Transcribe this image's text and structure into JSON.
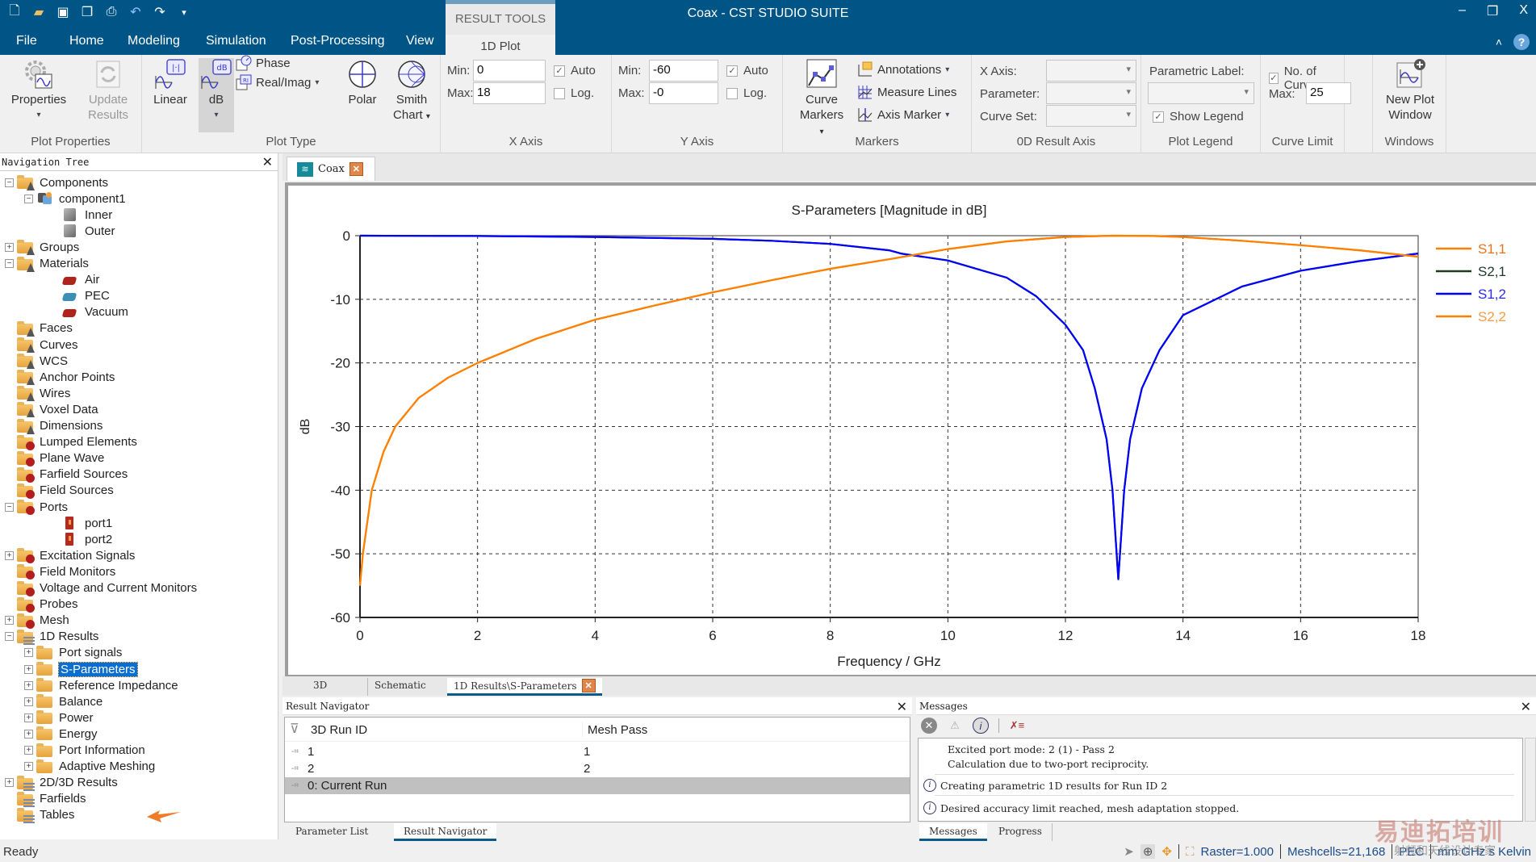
{
  "titlebar": {
    "title": "Coax - CST STUDIO SUITE",
    "qat_icons": [
      "new-icon",
      "open-icon",
      "save-icon",
      "copy-icon",
      "print-icon",
      "undo-icon",
      "redo-icon",
      "customize-icon"
    ],
    "window_controls": [
      "minimize",
      "restore",
      "close"
    ]
  },
  "tabs": {
    "items": [
      "File",
      "Home",
      "Modeling",
      "Simulation",
      "Post-Processing",
      "View"
    ],
    "context_header": "RESULT TOOLS",
    "context_tab": "1D Plot",
    "help": "?"
  },
  "ribbon": {
    "plot_properties": {
      "label": "Plot Properties",
      "properties": "Properties",
      "update_results_line1": "Update",
      "update_results_line2": "Results"
    },
    "plot_type": {
      "label": "Plot Type",
      "linear": "Linear",
      "db": "dB",
      "phase": "Phase",
      "real_imag": "Real/Imag",
      "polar": "Polar",
      "smith_line1": "Smith",
      "smith_line2": "Chart"
    },
    "x_axis": {
      "label": "X Axis",
      "min_label": "Min:",
      "min_value": "0",
      "max_label": "Max:",
      "max_value": "18",
      "auto_label": "Auto",
      "auto_checked": true,
      "log_label": "Log.",
      "log_checked": false
    },
    "y_axis": {
      "label": "Y Axis",
      "min_label": "Min:",
      "min_value": "-60",
      "max_label": "Max:",
      "max_value": "-0",
      "auto_label": "Auto",
      "auto_checked": true,
      "log_label": "Log.",
      "log_checked": false
    },
    "markers": {
      "label": "Markers",
      "curve_markers_line1": "Curve",
      "curve_markers_line2": "Markers",
      "annotations": "Annotations",
      "measure_lines": "Measure Lines",
      "axis_marker": "Axis Marker"
    },
    "result_axis_0d": {
      "label": "0D Result Axis",
      "x_axis_label": "X Axis:",
      "parameter_label": "Parameter:",
      "curve_set_label": "Curve Set:",
      "x_axis_value": "",
      "parameter_value": "",
      "curve_set_value": ""
    },
    "plot_legend": {
      "label": "Plot Legend",
      "parametric_label": "Parametric Label:",
      "parametric_value": "",
      "show_legend": "Show Legend",
      "show_legend_checked": true
    },
    "curve_limit": {
      "label": "Curve Limit",
      "no_of_curves": "No. of Curves",
      "no_of_curves_checked": true,
      "max_label": "Max:",
      "max_value": "25"
    },
    "windows": {
      "label": "Windows",
      "new_plot_line1": "New Plot",
      "new_plot_line2": "Window"
    }
  },
  "nav": {
    "title": "Navigation Tree",
    "items": [
      {
        "label": "Components",
        "level": 0,
        "toggle": "-",
        "icon": "folder-geometry"
      },
      {
        "label": "component1",
        "level": 1,
        "toggle": "-",
        "icon": "component"
      },
      {
        "label": "Inner",
        "level": 2,
        "toggle": "",
        "icon": "solid"
      },
      {
        "label": "Outer",
        "level": 2,
        "toggle": "",
        "icon": "solid"
      },
      {
        "label": "Groups",
        "level": 0,
        "toggle": "+",
        "icon": "folder-geometry"
      },
      {
        "label": "Materials",
        "level": 0,
        "toggle": "-",
        "icon": "folder-geometry"
      },
      {
        "label": "Air",
        "level": 2,
        "toggle": "",
        "icon": "material-red"
      },
      {
        "label": "PEC",
        "level": 2,
        "toggle": "",
        "icon": "material-blue"
      },
      {
        "label": "Vacuum",
        "level": 2,
        "toggle": "",
        "icon": "material-red"
      },
      {
        "label": "Faces",
        "level": 0,
        "toggle": "",
        "icon": "folder-geometry"
      },
      {
        "label": "Curves",
        "level": 0,
        "toggle": "",
        "icon": "folder-geometry"
      },
      {
        "label": "WCS",
        "level": 0,
        "toggle": "",
        "icon": "folder-geometry"
      },
      {
        "label": "Anchor Points",
        "level": 0,
        "toggle": "",
        "icon": "folder-geometry"
      },
      {
        "label": "Wires",
        "level": 0,
        "toggle": "",
        "icon": "folder-geometry"
      },
      {
        "label": "Voxel Data",
        "level": 0,
        "toggle": "",
        "icon": "folder-geometry"
      },
      {
        "label": "Dimensions",
        "level": 0,
        "toggle": "",
        "icon": "folder-geometry"
      },
      {
        "label": "Lumped Elements",
        "level": 0,
        "toggle": "",
        "icon": "folder-simulation"
      },
      {
        "label": "Plane Wave",
        "level": 0,
        "toggle": "",
        "icon": "folder-simulation"
      },
      {
        "label": "Farfield Sources",
        "level": 0,
        "toggle": "",
        "icon": "folder-simulation"
      },
      {
        "label": "Field Sources",
        "level": 0,
        "toggle": "",
        "icon": "folder-simulation"
      },
      {
        "label": "Ports",
        "level": 0,
        "toggle": "-",
        "icon": "folder-simulation"
      },
      {
        "label": "port1",
        "level": 2,
        "toggle": "",
        "icon": "port"
      },
      {
        "label": "port2",
        "level": 2,
        "toggle": "",
        "icon": "port"
      },
      {
        "label": "Excitation Signals",
        "level": 0,
        "toggle": "+",
        "icon": "folder-simulation"
      },
      {
        "label": "Field Monitors",
        "level": 0,
        "toggle": "",
        "icon": "folder-simulation"
      },
      {
        "label": "Voltage and Current Monitors",
        "level": 0,
        "toggle": "",
        "icon": "folder-simulation"
      },
      {
        "label": "Probes",
        "level": 0,
        "toggle": "",
        "icon": "folder-simulation"
      },
      {
        "label": "Mesh",
        "level": 0,
        "toggle": "+",
        "icon": "folder-simulation"
      },
      {
        "label": "1D Results",
        "level": 0,
        "toggle": "-",
        "icon": "folder-results"
      },
      {
        "label": "Port signals",
        "level": 1,
        "toggle": "+",
        "icon": "folder"
      },
      {
        "label": "S-Parameters",
        "level": 1,
        "toggle": "+",
        "icon": "folder",
        "selected": true
      },
      {
        "label": "Reference Impedance",
        "level": 1,
        "toggle": "+",
        "icon": "folder"
      },
      {
        "label": "Balance",
        "level": 1,
        "toggle": "+",
        "icon": "folder"
      },
      {
        "label": "Power",
        "level": 1,
        "toggle": "+",
        "icon": "folder"
      },
      {
        "label": "Energy",
        "level": 1,
        "toggle": "+",
        "icon": "folder"
      },
      {
        "label": "Port Information",
        "level": 1,
        "toggle": "+",
        "icon": "folder"
      },
      {
        "label": "Adaptive Meshing",
        "level": 1,
        "toggle": "+",
        "icon": "folder"
      },
      {
        "label": "2D/3D Results",
        "level": 0,
        "toggle": "+",
        "icon": "folder-results"
      },
      {
        "label": "Farfields",
        "level": 0,
        "toggle": "",
        "icon": "folder-results"
      },
      {
        "label": "Tables",
        "level": 0,
        "toggle": "",
        "icon": "folder-results"
      }
    ]
  },
  "doc_tab": {
    "label": "Coax"
  },
  "chart_data": {
    "type": "line",
    "title": "S-Parameters [Magnitude in dB]",
    "xlabel": "Frequency / GHz",
    "ylabel": "dB",
    "xlim": [
      0,
      18
    ],
    "ylim": [
      -60,
      0
    ],
    "xticks": [
      0,
      2,
      4,
      6,
      8,
      10,
      12,
      14,
      16,
      18
    ],
    "yticks": [
      0,
      -10,
      -20,
      -30,
      -40,
      -50,
      -60
    ],
    "grid": true,
    "legend_position": "right",
    "series": [
      {
        "name": "S2,2",
        "color": "#ff8000",
        "x": [
          0,
          0.05,
          0.2,
          0.4,
          0.6,
          1,
          1.5,
          2,
          3,
          4,
          5,
          6,
          7,
          8,
          9,
          10,
          11,
          12,
          12.8,
          13.5,
          14,
          15,
          16,
          17,
          18
        ],
        "y": [
          -55,
          -50,
          -40,
          -34,
          -30,
          -25.5,
          -22.3,
          -20,
          -16.2,
          -13.2,
          -11,
          -8.9,
          -7,
          -5.2,
          -3.7,
          -2.1,
          -0.9,
          -0.2,
          0,
          -0.05,
          -0.2,
          -0.8,
          -1.5,
          -2.3,
          -3.3
        ]
      },
      {
        "name": "S2,1",
        "color": "#1d3a1d",
        "x": [
          0,
          2,
          4,
          6,
          7,
          8,
          9,
          9.2,
          10,
          11,
          11.5,
          12,
          12.3,
          12.5,
          12.7,
          12.8,
          12.9,
          13.0,
          13.1,
          13.3,
          13.6,
          14,
          15,
          16,
          17,
          18
        ],
        "y": [
          0,
          -0.05,
          -0.2,
          -0.5,
          -0.8,
          -1.3,
          -2.3,
          -2.8,
          -3.9,
          -6.6,
          -9.5,
          -14,
          -18,
          -24,
          -32,
          -40,
          -54,
          -40,
          -32,
          -24,
          -18,
          -12.5,
          -8,
          -5.5,
          -4,
          -2.8
        ]
      },
      {
        "name": "S1,2",
        "color": "#0000ff",
        "x": [
          0,
          2,
          4,
          6,
          7,
          8,
          9,
          9.2,
          10,
          11,
          11.5,
          12,
          12.3,
          12.5,
          12.7,
          12.8,
          12.9,
          13.0,
          13.1,
          13.3,
          13.6,
          14,
          15,
          16,
          17,
          18
        ],
        "y": [
          0,
          -0.05,
          -0.2,
          -0.5,
          -0.8,
          -1.3,
          -2.3,
          -2.8,
          -3.9,
          -6.6,
          -9.5,
          -14,
          -18,
          -24,
          -32,
          -40,
          -54,
          -40,
          -32,
          -24,
          -18,
          -12.5,
          -8,
          -5.5,
          -4,
          -2.8
        ]
      },
      {
        "name": "S1,1",
        "color": "#ff8000",
        "x": [
          0,
          0.05,
          0.2,
          0.4,
          0.6,
          1,
          1.5,
          2,
          3,
          4,
          5,
          6,
          7,
          8,
          9,
          10,
          11,
          12,
          12.8,
          13.5,
          14,
          15,
          16,
          17,
          18
        ],
        "y": [
          -55,
          -50,
          -40,
          -34,
          -30,
          -25.5,
          -22.3,
          -20,
          -16.2,
          -13.2,
          -11,
          -8.9,
          -7,
          -5.2,
          -3.7,
          -2.1,
          -0.9,
          -0.2,
          0,
          -0.05,
          -0.2,
          -0.8,
          -1.5,
          -2.3,
          -3.3
        ]
      }
    ],
    "legend": [
      {
        "name": "S1,1",
        "color": "#ff8000",
        "text_color": "#e8741a"
      },
      {
        "name": "S2,1",
        "color": "#1d3a1d",
        "text_color": "#1d3a2a"
      },
      {
        "name": "S1,2",
        "color": "#0000ff",
        "text_color": "#2a2af0"
      },
      {
        "name": "S2,2",
        "color": "#ff8000",
        "text_color": "#f59a45"
      }
    ]
  },
  "view_tabs": {
    "items": [
      "3D",
      "Schematic",
      "1D Results\\S-Parameters"
    ],
    "active": 2
  },
  "result_navigator": {
    "title": "Result Navigator",
    "columns": [
      "3D Run ID",
      "Mesh Pass"
    ],
    "rows": [
      {
        "run_id": "1",
        "mesh_pass": "1"
      },
      {
        "run_id": "2",
        "mesh_pass": "2"
      },
      {
        "run_id": "0: Current Run",
        "mesh_pass": ""
      }
    ],
    "tabs": [
      "Parameter List",
      "Result Navigator"
    ]
  },
  "messages": {
    "title": "Messages",
    "lines": [
      {
        "text": "Excited port mode: 2 (1) - Pass 2",
        "info": false
      },
      {
        "text": "Calculation due to two-port reciprocity.",
        "info": false
      },
      {
        "text": "Creating parametric 1D results for Run ID 2",
        "info": true
      },
      {
        "text": "Desired accuracy limit reached, mesh adaptation stopped.",
        "info": true
      }
    ],
    "tabs": [
      "Messages",
      "Progress"
    ]
  },
  "statusbar": {
    "status": "Ready",
    "raster": "Raster=1.000",
    "meshcells": "Meshcells=21,168",
    "material": "PEC",
    "units": "mm  GHz  s  Kelvin"
  },
  "watermark": {
    "main": "易迪拓培训",
    "sub": "射频和天线设计专家"
  }
}
